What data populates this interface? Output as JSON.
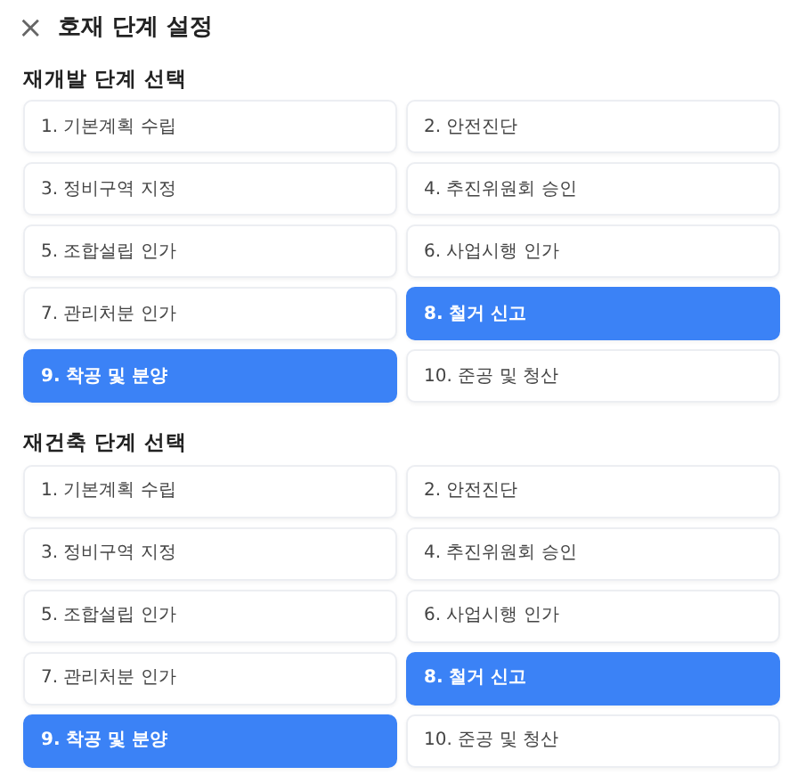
{
  "header": {
    "close_icon": "×",
    "title": "호재 단계 설정"
  },
  "sections": [
    {
      "title": "재개발 단계 선택",
      "stages": [
        {
          "label": "1. 기본계획 수립",
          "selected": false
        },
        {
          "label": "2. 안전진단",
          "selected": false
        },
        {
          "label": "3. 정비구역 지정",
          "selected": false
        },
        {
          "label": "4. 추진위원회 승인",
          "selected": false
        },
        {
          "label": "5. 조합설립 인가",
          "selected": false
        },
        {
          "label": "6. 사업시행 인가",
          "selected": false
        },
        {
          "label": "7. 관리처분 인가",
          "selected": false
        },
        {
          "label": "8. 철거 신고",
          "selected": true
        },
        {
          "label": "9. 착공 및 분양",
          "selected": true
        },
        {
          "label": "10. 준공 및 청산",
          "selected": false
        }
      ]
    },
    {
      "title": "재건축 단계 선택",
      "stages": [
        {
          "label": "1. 기본계획 수립",
          "selected": false
        },
        {
          "label": "2. 안전진단",
          "selected": false
        },
        {
          "label": "3. 정비구역 지정",
          "selected": false
        },
        {
          "label": "4. 추진위원회 승인",
          "selected": false
        },
        {
          "label": "5. 조합설립 인가",
          "selected": false
        },
        {
          "label": "6. 사업시행 인가",
          "selected": false
        },
        {
          "label": "7. 관리처분 인가",
          "selected": false
        },
        {
          "label": "8. 철거 신고",
          "selected": true
        },
        {
          "label": "9. 착공 및 분양",
          "selected": true
        },
        {
          "label": "10. 준공 및 청산",
          "selected": false
        }
      ]
    }
  ]
}
